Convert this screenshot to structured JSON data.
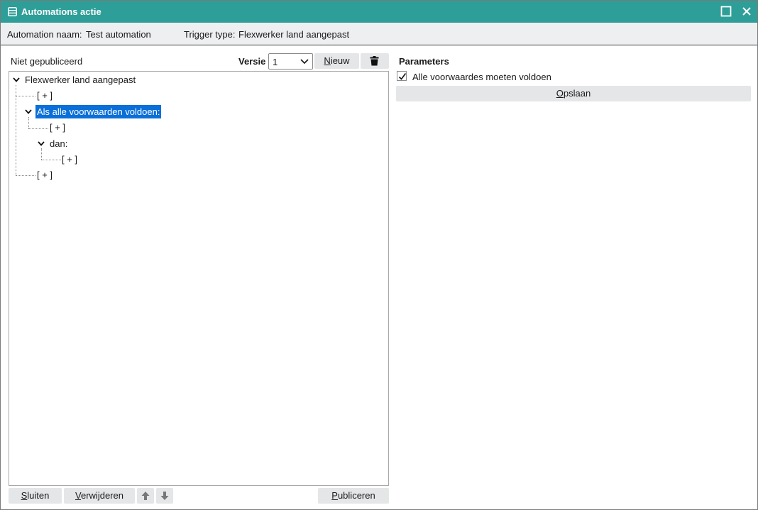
{
  "window": {
    "title": "Automations actie",
    "icon": "list-window-icon",
    "title_bar_color": "#2e9e98"
  },
  "info_bar": {
    "automation_name_label": "Automation naam:",
    "automation_name_value": "Test automation",
    "trigger_type_label": "Trigger type:",
    "trigger_type_value": "Flexwerker land aangepast"
  },
  "left_panel": {
    "status": "Niet gepubliceerd",
    "version_label": "Versie",
    "version_value": "1",
    "new_button": {
      "underlined": "N",
      "rest": "ieuw"
    },
    "delete_icon": "trash-icon"
  },
  "tree": {
    "root": "Flexwerker land aangepast",
    "add_1": "[ + ]",
    "condition": "Als alle voorwaarden voldoen:",
    "add_2": "[ + ]",
    "then": "dan:",
    "add_3": "[ + ]",
    "add_4": "[ + ]",
    "selected_color": "#0a6fd8"
  },
  "parameters": {
    "title": "Parameters",
    "checkbox_label": "Alle voorwaardes moeten voldoen",
    "checkbox_checked": true,
    "save_button": {
      "underlined": "O",
      "rest": "pslaan"
    }
  },
  "footer": {
    "close_button": {
      "underlined": "S",
      "rest": "luiten"
    },
    "remove_button": {
      "underlined": "V",
      "rest": "erwijderen"
    },
    "publish_button": {
      "underlined": "P",
      "rest": "ubliceren"
    },
    "up_icon": "arrow-up-icon",
    "down_icon": "arrow-down-icon"
  }
}
